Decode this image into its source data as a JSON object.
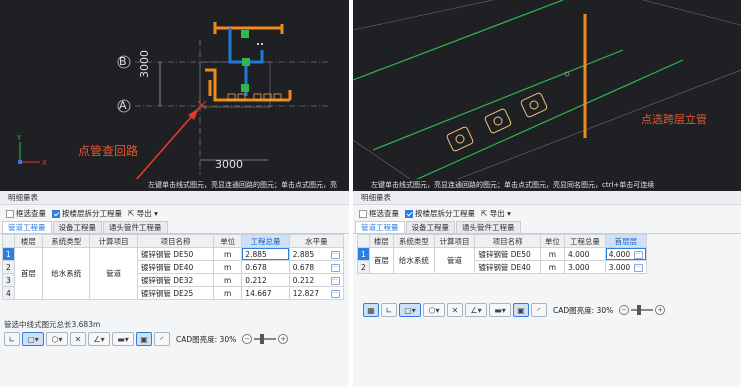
{
  "left": {
    "cad": {
      "axis_b": "B",
      "axis_a": "A",
      "dim_vertical": "3000",
      "dim_horizontal": "3000",
      "annotation": "点管查回路",
      "hint": "左键单击线式图元，亮显连通回路的图元；单击点式图元，亮"
    },
    "panel_title": "明细量表",
    "opts": {
      "filter_label": "框选查量",
      "split_label": "按楼层拆分工程量",
      "export_label": "导出"
    },
    "tabs": [
      "管道工程量",
      "设备工程量",
      "通头管件工程量"
    ],
    "table": {
      "headers": [
        "楼层",
        "系统类型",
        "计算项目",
        "项目名称",
        "单位",
        "工程总量",
        "水平量"
      ],
      "floor": "首层",
      "system": "给水系统",
      "item": "管道",
      "rows": [
        {
          "n": "1",
          "name": "镀锌钢管 DE50",
          "unit": "m",
          "total": "2.885",
          "horiz": "2.885"
        },
        {
          "n": "2",
          "name": "镀锌钢管 DE40",
          "unit": "m",
          "total": "0.678",
          "horiz": "0.678"
        },
        {
          "n": "3",
          "name": "镀锌钢管 DE32",
          "unit": "m",
          "total": "0.212",
          "horiz": "0.212"
        },
        {
          "n": "4",
          "name": "镀锌钢管 DE25",
          "unit": "m",
          "total": "14.667",
          "horiz": "12.827"
        }
      ]
    },
    "status": "管选中线式图元总长3.683m",
    "bright_label": "CAD图亮度: 30%"
  },
  "right": {
    "cad": {
      "annotation": "点选跨层立管",
      "hint": "左键单击线式图元，亮显连通回路的图元；单击点式图元，亮显同名图元，ctrl+单击可连续"
    },
    "panel_title": "明细量表",
    "opts": {
      "filter_label": "框选查量",
      "split_label": "按楼层拆分工程量",
      "export_label": "导出"
    },
    "tabs": [
      "管道工程量",
      "设备工程量",
      "通头管件工程量"
    ],
    "table": {
      "headers": [
        "楼层",
        "系统类型",
        "计算项目",
        "项目名称",
        "单位",
        "工程总量",
        "首层层"
      ],
      "floor": "首层",
      "system": "给水系统",
      "item": "管道",
      "rows": [
        {
          "n": "1",
          "name": "镀锌钢管 DE50",
          "unit": "m",
          "total": "4.000",
          "extra": "4.000"
        },
        {
          "n": "2",
          "name": "镀锌钢管 DE40",
          "unit": "m",
          "total": "3.000",
          "extra": "3.000"
        }
      ]
    },
    "bright_label": "CAD图亮度: 30%"
  },
  "colors": {
    "cad_bg": "#1f2024",
    "pipe_orange": "#f28a1e",
    "pipe_blue": "#1e7ad8",
    "pipe_green": "#2fb84a",
    "accent_red": "#e8562e",
    "highlight_blue": "#2f7de1"
  }
}
